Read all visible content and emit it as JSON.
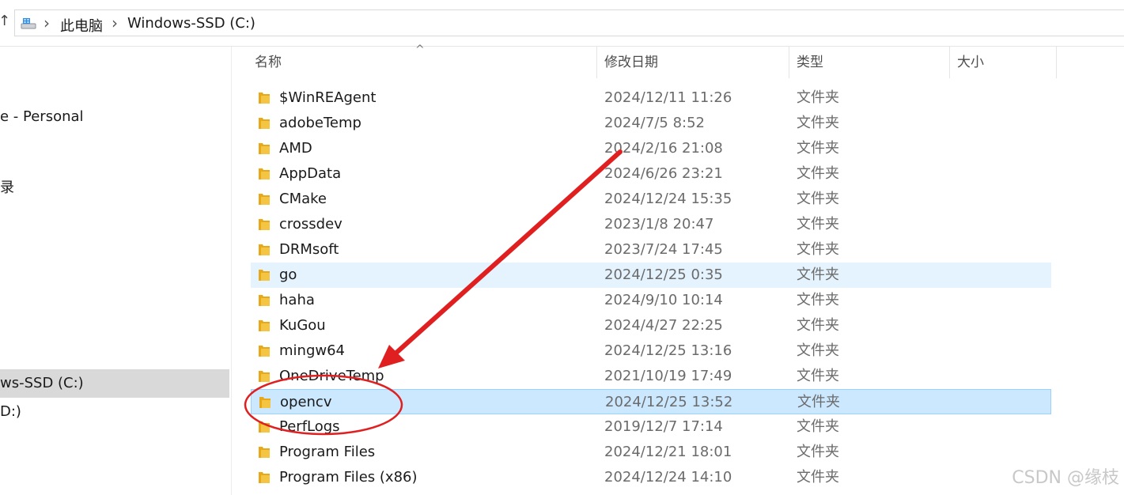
{
  "address": {
    "up_arrow": "↑",
    "crumbs": [
      "此电脑",
      "Windows-SSD (C:)"
    ],
    "separator": "›"
  },
  "nav": {
    "items": [
      {
        "label": "e - Personal"
      },
      {
        "label": "录"
      },
      {
        "label": "ws-SSD (C:)"
      },
      {
        "label": "D:)"
      }
    ]
  },
  "columns": {
    "name": "名称",
    "date": "修改日期",
    "type": "类型",
    "size": "大小"
  },
  "files": [
    {
      "name": "$WinREAgent",
      "date": "2024/12/11 11:26",
      "type": "文件夹"
    },
    {
      "name": "adobeTemp",
      "date": "2024/7/5 8:52",
      "type": "文件夹"
    },
    {
      "name": "AMD",
      "date": "2024/2/16 21:08",
      "type": "文件夹"
    },
    {
      "name": "AppData",
      "date": "2024/6/26 23:21",
      "type": "文件夹"
    },
    {
      "name": "CMake",
      "date": "2024/12/24 15:35",
      "type": "文件夹"
    },
    {
      "name": "crossdev",
      "date": "2023/1/8 20:47",
      "type": "文件夹"
    },
    {
      "name": "DRMsoft",
      "date": "2023/7/24 17:45",
      "type": "文件夹"
    },
    {
      "name": "go",
      "date": "2024/12/25 0:35",
      "type": "文件夹"
    },
    {
      "name": "haha",
      "date": "2024/9/10 10:14",
      "type": "文件夹"
    },
    {
      "name": "KuGou",
      "date": "2024/4/27 22:25",
      "type": "文件夹"
    },
    {
      "name": "mingw64",
      "date": "2024/12/25 13:16",
      "type": "文件夹"
    },
    {
      "name": "OneDriveTemp",
      "date": "2021/10/19 17:49",
      "type": "文件夹"
    },
    {
      "name": "opencv",
      "date": "2024/12/25 13:52",
      "type": "文件夹"
    },
    {
      "name": "PerfLogs",
      "date": "2019/12/7 17:14",
      "type": "文件夹"
    },
    {
      "name": "Program Files",
      "date": "2024/12/21 18:01",
      "type": "文件夹"
    },
    {
      "name": "Program Files (x86)",
      "date": "2024/12/24 14:10",
      "type": "文件夹"
    }
  ],
  "watermark": "CSDN @缘枝",
  "colors": {
    "hover_row": "#e5f3ff",
    "selected_row": "#cce8ff",
    "annotation": "#e02020",
    "folder": "#f4c542"
  }
}
